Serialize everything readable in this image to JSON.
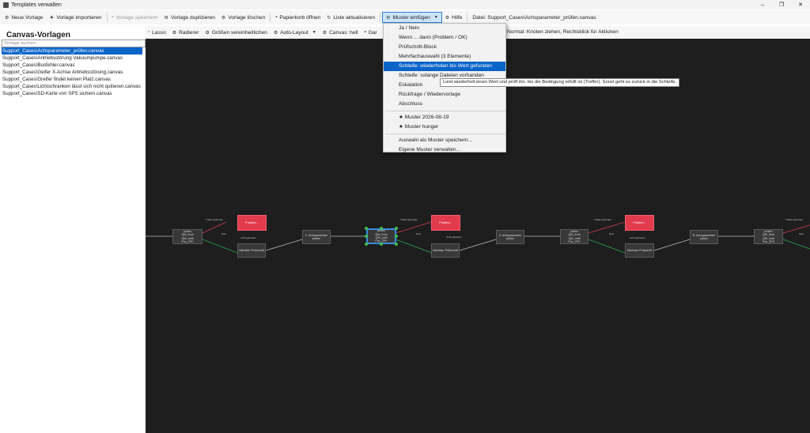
{
  "window": {
    "title": "Templates verwalten",
    "minimize": "–",
    "maximize": "❐",
    "close": "✕"
  },
  "toolbar": {
    "new_template": "Neue Vorlage",
    "import_template": "Vorlage importieren",
    "save_template": "Vorlage speichern",
    "duplicate_template": "Vorlage duplizieren",
    "delete_template": "Vorlage löschen",
    "open_trash": "Papierkorb öffnen",
    "refresh_list": "Liste aktualisieren",
    "insert_pattern": "Muster einfügen",
    "help": "Hilfe",
    "file_info": "Datei: Support_Cases\\Achsparameter_prüfen.canvas"
  },
  "left_panel": {
    "title": "Canvas-Vorlagen",
    "search_placeholder": "Vorlage suchen...",
    "files": [
      "Support_Cases\\Achsparameter_prüfen.canvas",
      "Support_Cases\\Antriebsstörung Vakuumpumpe.canvas",
      "Support_Cases\\Busfehler.canvas",
      "Support_Cases\\Geifer X-Achse Antriebsstörung.canvas",
      "Support_Cases\\Greifer findet keinen Platz.canvas",
      "Support_Cases\\Lichtschranken lässt sich nicht quitieren.canvas",
      "Support_Cases\\SD-Karte von SPS sichern.canvas"
    ]
  },
  "canvas_toolbar": {
    "lasso": "Lasso",
    "eraser": "Radierer",
    "unify_sizes": "Größen vereinheitlichen",
    "auto_layout": "Auto-Layout",
    "canvas_theme": "Canvas: hell",
    "partial": "Gar",
    "mode_hint": "Normal: Knoten ziehen, Rechtsklick für Aktionen"
  },
  "menu": {
    "items": [
      "Ja / Nein",
      "Wenn ... dann (Problem / OK)",
      "Prüfschritt-Block",
      "Mehrfachauswahl (3 Elemente)",
      "Schleife: wiederholen bis Wert gefunden",
      "Schleife: solange Dateien vorhanden",
      "Eskalation",
      "Rückfrage / Wiedervorlage",
      "Abschluss"
    ],
    "custom": [
      "★ Muster 2026-08-19",
      "★ Muster hunger"
    ],
    "actions": [
      "Auswahl als Muster speichern...",
      "Eigene Muster verwalten..."
    ]
  },
  "tooltip": "Liest wiederholt einen Wert und prüft ihn, bis die Bedingung erfüllt ist (Treffer). Sonst geht es zurück in die Schleife.",
  "canvas": {
    "loop_node": "prüfen\nQW_from\nQW_until\nPos_ZPK",
    "problem_node": "Problem...",
    "next_node": "Nächster Prüfschritt",
    "edge_found": "Treffer gefunden",
    "edge_no": "Nein",
    "edge_not_found": "nicht gefunden",
    "param_nodes": [
      "F: Achsparameter\nprüfen",
      "Z: Achsparameter\nprüfen",
      "R: Achsparameter\nprüfen"
    ]
  },
  "colors": {
    "accent": "#0a64c8",
    "problem": "#e23b4e",
    "yes_edge": "#2ea84a",
    "no_edge": "#d23c4c",
    "canvas_bg": "#1e1e1e"
  }
}
